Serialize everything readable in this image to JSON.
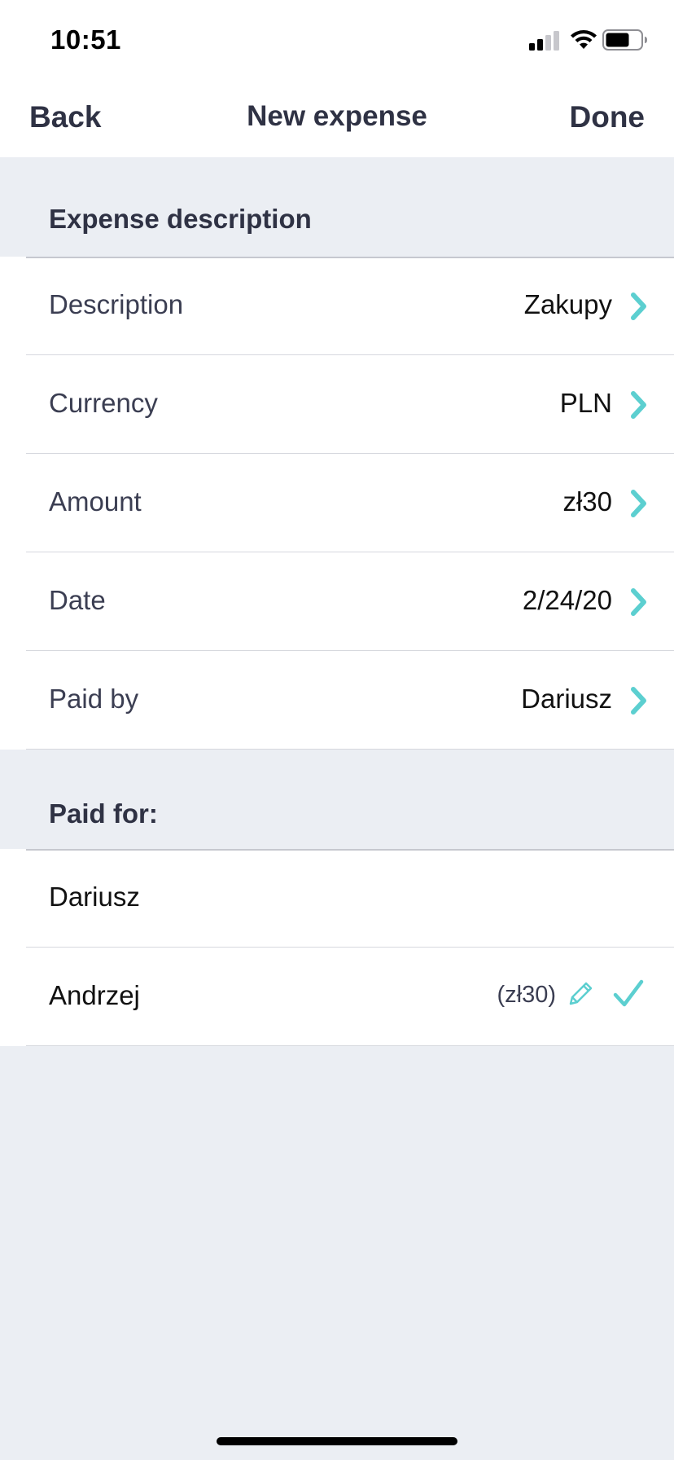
{
  "status_bar": {
    "time": "10:51"
  },
  "nav": {
    "back_label": "Back",
    "title": "New expense",
    "done_label": "Done"
  },
  "expense_section": {
    "header": "Expense description",
    "rows": [
      {
        "label": "Description",
        "value": "Zakupy"
      },
      {
        "label": "Currency",
        "value": "PLN"
      },
      {
        "label": "Amount",
        "value": "zł30"
      },
      {
        "label": "Date",
        "value": "2/24/20"
      },
      {
        "label": "Paid by",
        "value": "Dariusz"
      }
    ]
  },
  "paid_for_section": {
    "header": "Paid for:",
    "people": [
      {
        "name": "Dariusz",
        "share": "",
        "selected": false
      },
      {
        "name": "Andrzej",
        "share": "(zł30)",
        "selected": true
      }
    ]
  },
  "colors": {
    "accent": "#5ccfd0",
    "text_primary": "#2f3244",
    "background": "#ebeef3"
  },
  "icons": [
    "signal-icon",
    "wifi-icon",
    "battery-icon",
    "chevron-right-icon",
    "pencil-icon",
    "checkmark-icon"
  ]
}
